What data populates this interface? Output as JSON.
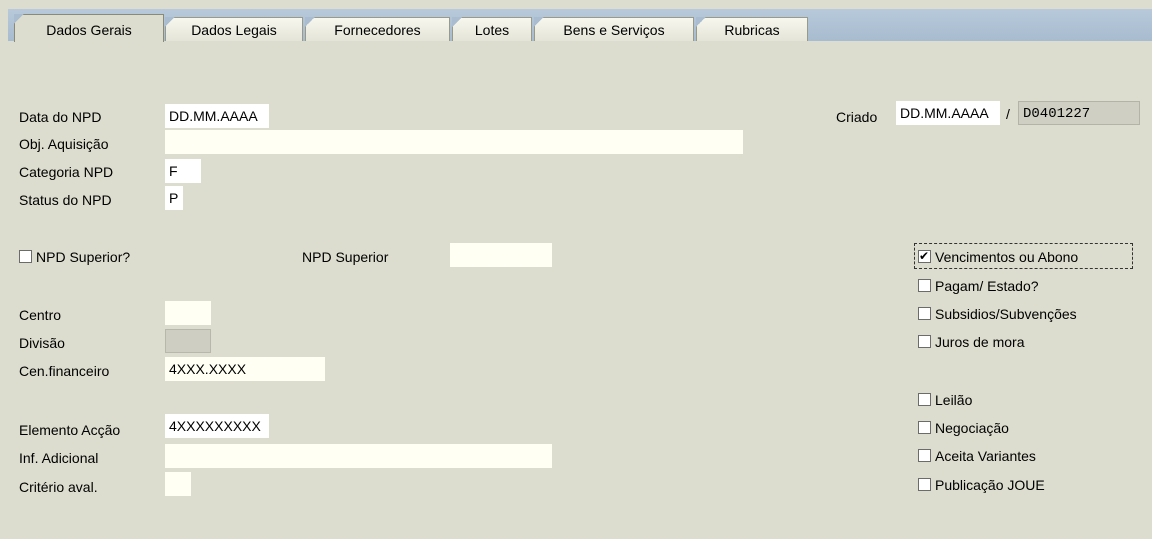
{
  "tabs": [
    {
      "label": "Dados Gerais",
      "active": true
    },
    {
      "label": "Dados Legais",
      "active": false
    },
    {
      "label": "Fornecedores",
      "active": false
    },
    {
      "label": "Lotes",
      "active": false
    },
    {
      "label": "Bens e Serviços",
      "active": false
    },
    {
      "label": "Rubricas",
      "active": false
    }
  ],
  "form": {
    "data_npd": {
      "label": "Data do NPD",
      "value": "DD.MM.AAAA"
    },
    "obj_aquisicao": {
      "label": "Obj. Aquisição",
      "value": ""
    },
    "categoria": {
      "label": "Categoria NPD",
      "value": "F"
    },
    "status": {
      "label": "Status do NPD",
      "value": "P"
    },
    "criado": {
      "label": "Criado",
      "date": "DD.MM.AAAA",
      "separator": "/",
      "user": "D0401227"
    },
    "npd_superior_check": {
      "label": "NPD Superior?",
      "checked": false
    },
    "npd_superior": {
      "label": "NPD Superior",
      "value": ""
    },
    "centro": {
      "label": "Centro",
      "value": ""
    },
    "divisao": {
      "label": "Divisão",
      "value": ""
    },
    "cen_financeiro": {
      "label": "Cen.financeiro",
      "value": "4XXX.XXXX"
    },
    "elemento_accao": {
      "label": "Elemento Acção",
      "value": "4XXXXXXXXX"
    },
    "inf_adicional": {
      "label": "Inf. Adicional",
      "value": ""
    },
    "criterio_aval": {
      "label": "Critério aval.",
      "value": ""
    }
  },
  "checks": [
    {
      "label": "Vencimentos ou Abono",
      "checked": true
    },
    {
      "label": "Pagam/ Estado?",
      "checked": false
    },
    {
      "label": "Subsidios/Subvenções",
      "checked": false
    },
    {
      "label": "Juros de mora",
      "checked": false
    },
    {
      "label": "Leilão",
      "checked": false
    },
    {
      "label": "Negociação",
      "checked": false
    },
    {
      "label": "Aceita Variantes",
      "checked": false
    },
    {
      "label": "Publicação JOUE",
      "checked": false
    }
  ]
}
